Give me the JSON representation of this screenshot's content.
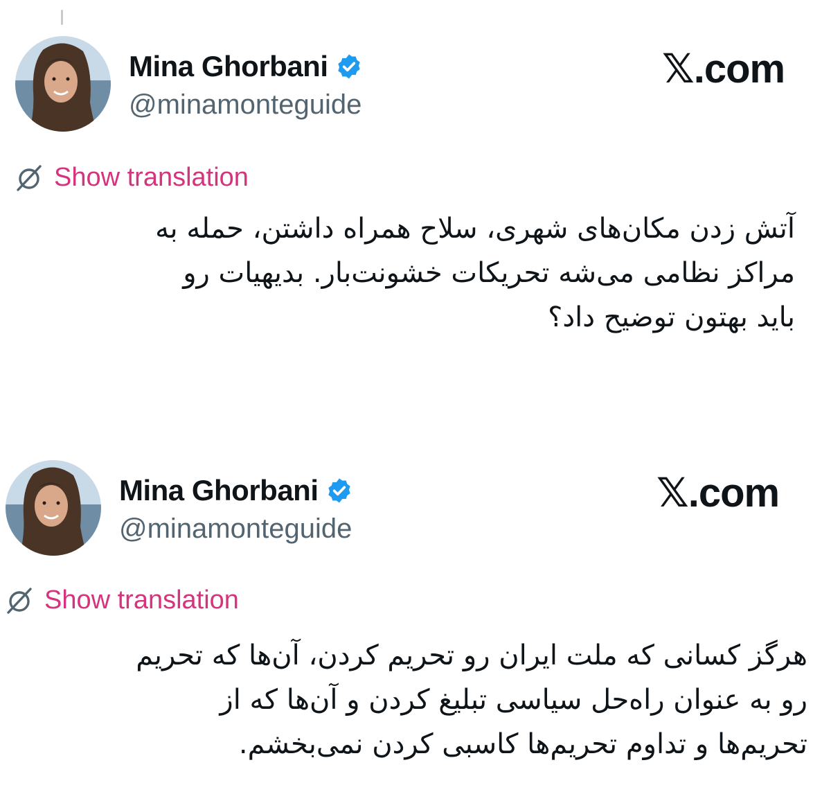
{
  "tweets": [
    {
      "author": {
        "display_name": "Mina Ghorbani",
        "handle": "@minamonteguide",
        "verified": true,
        "avatar_icon": "avatar-photo"
      },
      "brand": "𝕏.com",
      "translate_label": "Show translation",
      "translate_icon": "globe-slash-icon",
      "text": "آتش زدن مکان‌های شهری، سلاح همراه داشتن، حمله به\nمراکز نظامی می‌شه تحریکات خشونت‌بار. بدیهیات رو\nباید بهتون توضیح داد؟"
    },
    {
      "author": {
        "display_name": "Mina Ghorbani",
        "handle": "@minamonteguide",
        "verified": true,
        "avatar_icon": "avatar-photo"
      },
      "brand": "𝕏.com",
      "translate_label": "Show translation",
      "translate_icon": "globe-slash-icon",
      "text": "هرگز کسانی که ملت ایران رو تحریم کردن، آن‌ها که تحریم\nرو به عنوان راه‌حل سیاسی تبلیغ کردن و آن‌ها که از\nتحریم‌ها و تداوم تحریم‌ها کاسبی کردن نمی‌بخشم."
    }
  ],
  "colors": {
    "link": "#d6337f",
    "handle": "#536471",
    "verified": "#1d9bf0",
    "text": "#0f1419"
  }
}
